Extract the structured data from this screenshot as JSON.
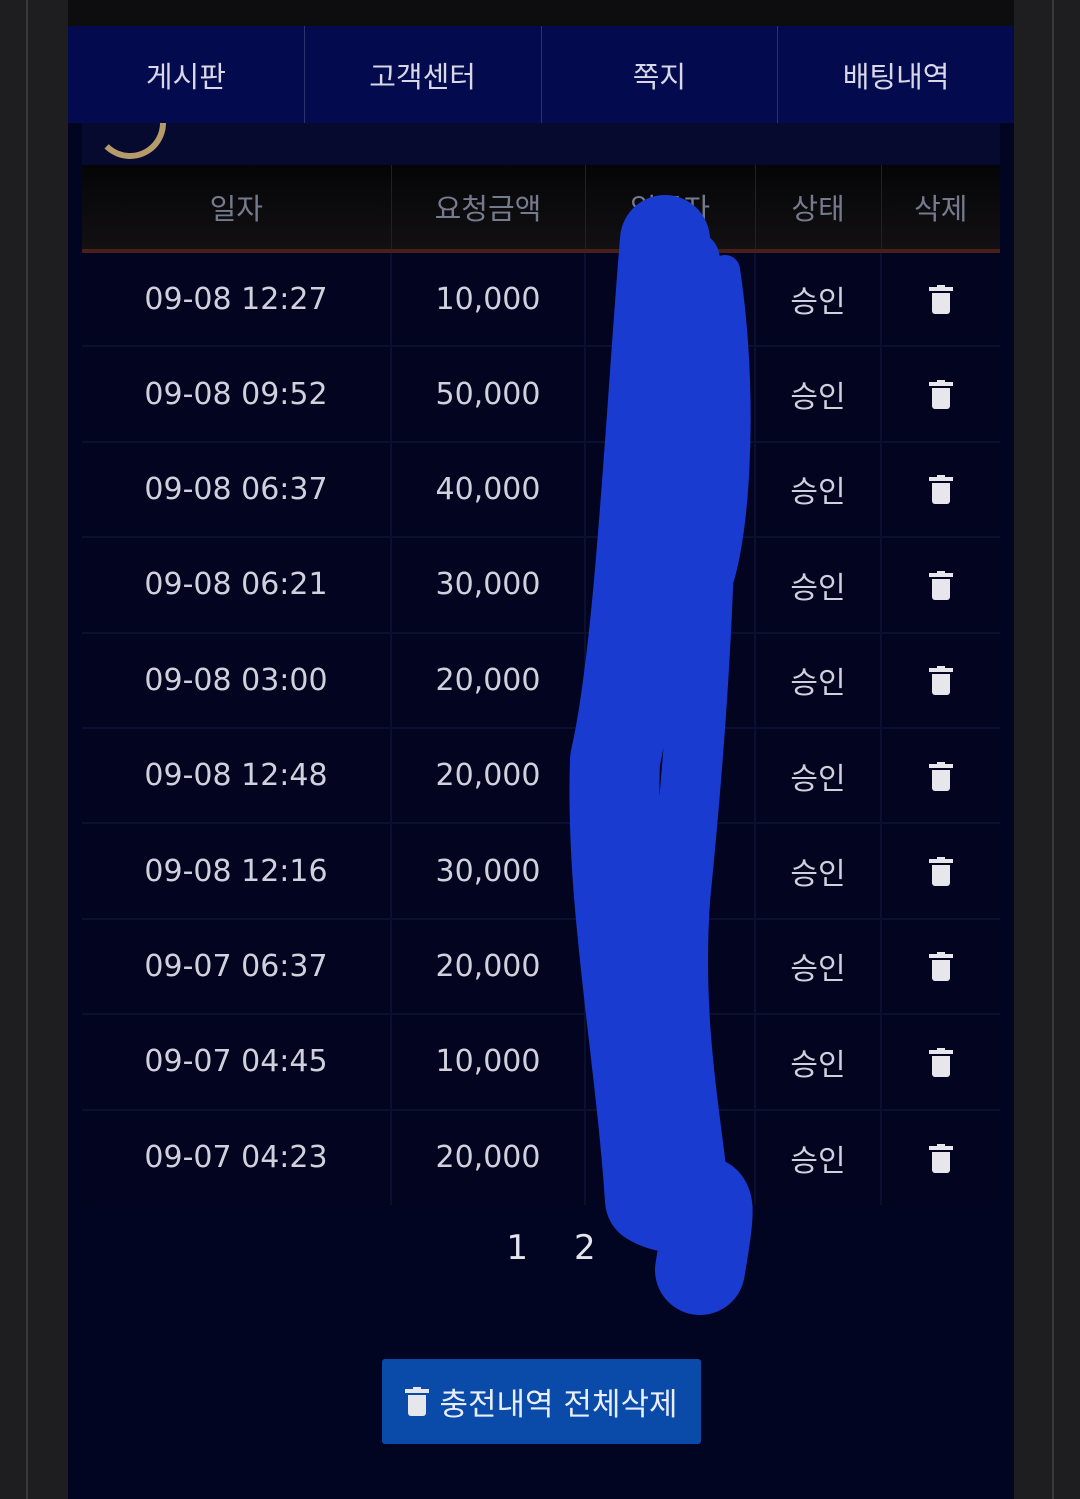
{
  "nav": {
    "items": [
      {
        "label": "게시판"
      },
      {
        "label": "고객센터"
      },
      {
        "label": "쪽지"
      },
      {
        "label": "배팅내역"
      }
    ]
  },
  "table": {
    "headers": [
      "일자",
      "요청금액",
      "입금자",
      "상태",
      "삭제"
    ],
    "rows": [
      {
        "date": "09-08 12:27",
        "amount": "10,000",
        "depositor": "",
        "status": "승인"
      },
      {
        "date": "09-08 09:52",
        "amount": "50,000",
        "depositor": "",
        "status": "승인"
      },
      {
        "date": "09-08 06:37",
        "amount": "40,000",
        "depositor": "",
        "status": "승인"
      },
      {
        "date": "09-08 06:21",
        "amount": "30,000",
        "depositor": "",
        "status": "승인"
      },
      {
        "date": "09-08 03:00",
        "amount": "20,000",
        "depositor": "",
        "status": "승인"
      },
      {
        "date": "09-08 12:48",
        "amount": "20,000",
        "depositor": "",
        "status": "승인"
      },
      {
        "date": "09-08 12:16",
        "amount": "30,000",
        "depositor": "",
        "status": "승인"
      },
      {
        "date": "09-07 06:37",
        "amount": "20,000",
        "depositor": "",
        "status": "승인"
      },
      {
        "date": "09-07 04:45",
        "amount": "10,000",
        "depositor": "",
        "status": "승인"
      },
      {
        "date": "09-07 04:23",
        "amount": "20,000",
        "depositor": "",
        "status": "승인"
      }
    ]
  },
  "pagination": {
    "pages": [
      "1",
      "2"
    ]
  },
  "actions": {
    "delete_all_label": "충전내역 전체삭제"
  },
  "icons": {
    "row_delete": "trash-icon",
    "title": "ring-icon"
  },
  "colors": {
    "nav_bg": "#040a4e",
    "page_bg": "#020522",
    "button_bg": "#0a4aa8",
    "redaction": "#1a3bd0"
  }
}
